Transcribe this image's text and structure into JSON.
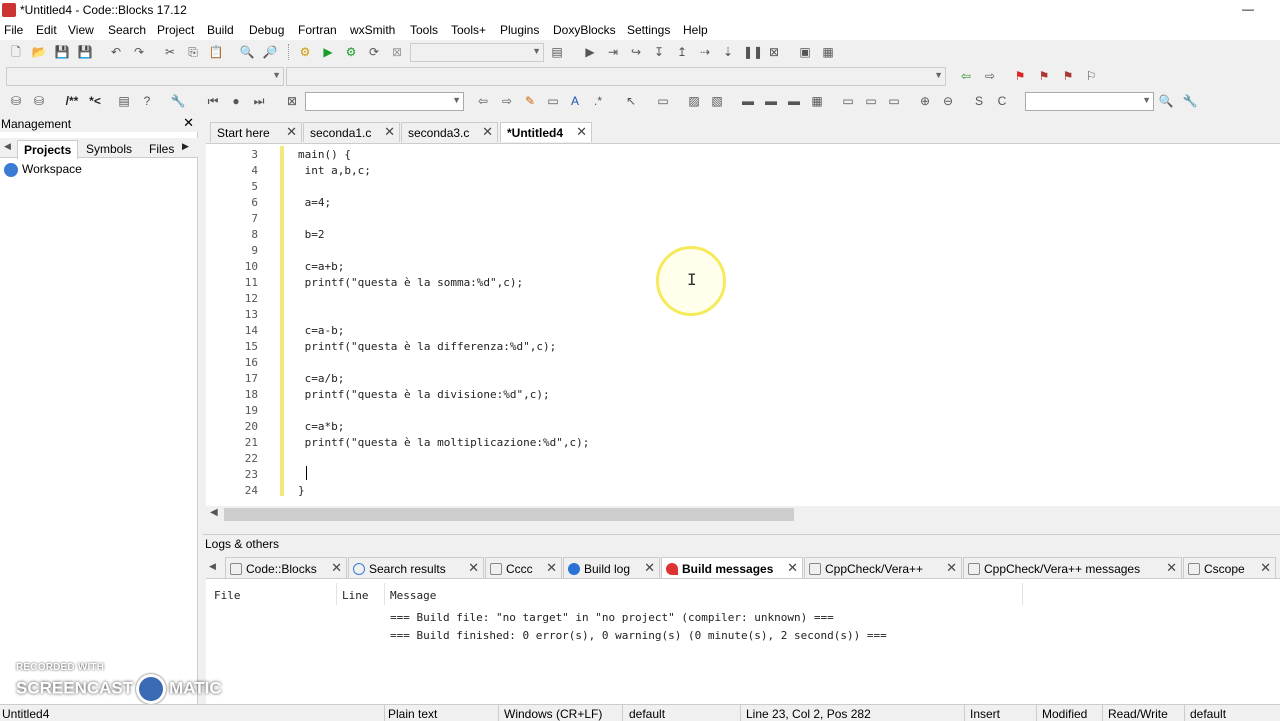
{
  "window": {
    "title": "*Untitled4 - Code::Blocks 17.12",
    "minimize": "—"
  },
  "menu": [
    "File",
    "Edit",
    "View",
    "Search",
    "Project",
    "Build",
    "Debug",
    "Fortran",
    "wxSmith",
    "Tools",
    "Tools+",
    "Plugins",
    "DoxyBlocks",
    "Settings",
    "Help"
  ],
  "toolbar3": {
    "doc_comment": "/**",
    "line_comment": "*<"
  },
  "management": {
    "title": "Management",
    "close": "✕",
    "tabs": [
      "Projects",
      "Symbols",
      "Files"
    ],
    "tab_prev": "◀",
    "tab_next": "▶",
    "workspace": "Workspace"
  },
  "editor_tabs": [
    {
      "label": "Start here",
      "close": "✕"
    },
    {
      "label": "seconda1.c",
      "close": "✕"
    },
    {
      "label": "seconda3.c",
      "close": "✕"
    },
    {
      "label": "*Untitled4",
      "close": "✕"
    }
  ],
  "code_lines": [
    {
      "num": "3",
      "text": "main() {"
    },
    {
      "num": "4",
      "text": " int a,b,c;"
    },
    {
      "num": "5",
      "text": ""
    },
    {
      "num": "6",
      "text": " a=4;"
    },
    {
      "num": "7",
      "text": ""
    },
    {
      "num": "8",
      "text": " b=2"
    },
    {
      "num": "9",
      "text": ""
    },
    {
      "num": "10",
      "text": " c=a+b;"
    },
    {
      "num": "11",
      "text": " printf(\"questa è la somma:%d\",c);"
    },
    {
      "num": "12",
      "text": ""
    },
    {
      "num": "13",
      "text": ""
    },
    {
      "num": "14",
      "text": " c=a-b;"
    },
    {
      "num": "15",
      "text": " printf(\"questa è la differenza:%d\",c);"
    },
    {
      "num": "16",
      "text": ""
    },
    {
      "num": "17",
      "text": " c=a/b;"
    },
    {
      "num": "18",
      "text": " printf(\"questa è la divisione:%d\",c);"
    },
    {
      "num": "19",
      "text": ""
    },
    {
      "num": "20",
      "text": " c=a*b;"
    },
    {
      "num": "21",
      "text": " printf(\"questa è la moltiplicazione:%d\",c);"
    },
    {
      "num": "22",
      "text": ""
    },
    {
      "num": "23",
      "text": ""
    },
    {
      "num": "24",
      "text": "}"
    }
  ],
  "logs": {
    "title": "Logs & others",
    "tab_prev": "◀",
    "tabs": [
      {
        "label": "Code::Blocks",
        "close": "✕"
      },
      {
        "label": "Search results",
        "close": "✕"
      },
      {
        "label": "Cccc",
        "close": "✕"
      },
      {
        "label": "Build log",
        "close": "✕"
      },
      {
        "label": "Build messages",
        "close": "✕"
      },
      {
        "label": "CppCheck/Vera++",
        "close": "✕"
      },
      {
        "label": "CppCheck/Vera++ messages",
        "close": "✕"
      },
      {
        "label": "Cscope",
        "close": "✕"
      }
    ],
    "columns": [
      "File",
      "Line",
      "Message"
    ],
    "messages": [
      "=== Build file: \"no target\" in \"no project\" (compiler: unknown) ===",
      "=== Build finished: 0 error(s), 0 warning(s) (0 minute(s), 2 second(s)) ==="
    ]
  },
  "watermark": {
    "line1": "RECORDED WITH",
    "part1": "SCREENCAST",
    "part2": "MATIC"
  },
  "status": {
    "file": "Untitled4",
    "language": "Plain text",
    "eol": "Windows (CR+LF)",
    "encoding": "default",
    "position": "Line 23, Col 2, Pos 282",
    "mode": "Insert",
    "modified": "Modified",
    "access": "Read/Write",
    "profile": "default"
  },
  "colors": {
    "changebar": "#f3e97a",
    "cursor_highlight": "#f6ea5a",
    "active_tab_bg": "#ffffff"
  }
}
